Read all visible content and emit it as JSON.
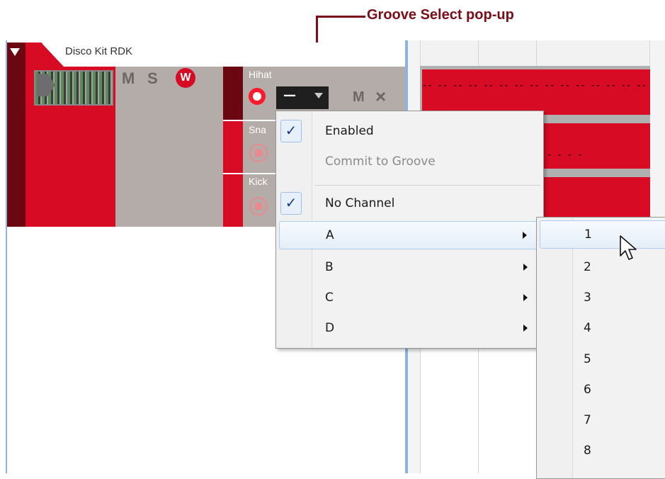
{
  "annotation": {
    "label": "Groove Select pop-up"
  },
  "track": {
    "name": "Disco Kit RDK",
    "mute_label": "M",
    "solo_label": "S",
    "wave_label": "W",
    "lanes": [
      {
        "label": "Hihat"
      },
      {
        "label": "Sna"
      },
      {
        "label": "Kick"
      }
    ],
    "lane_mute_label": "M",
    "lane_close_label": "×",
    "groove_select_value": "—"
  },
  "clips": {
    "hihat_notes": "-- -- -- -- -- -- -- -- -- -- -- -- -- -- -- -- -- -- -- -- -- -- -- -- --",
    "snare_notes": "-    -     -     -"
  },
  "groove_menu": {
    "items": [
      {
        "label": "Enabled",
        "checked": true,
        "enabled": true
      },
      {
        "label": "Commit to Groove",
        "checked": false,
        "enabled": false
      },
      {
        "label": "No Channel",
        "checked": true,
        "enabled": true
      },
      {
        "label": "A",
        "submenu": true,
        "highlighted": true
      },
      {
        "label": "B",
        "submenu": true
      },
      {
        "label": "C",
        "submenu": true
      },
      {
        "label": "D",
        "submenu": true
      }
    ],
    "check_glyph": "✓"
  },
  "channel_submenu": {
    "items": [
      "1",
      "2",
      "3",
      "4",
      "5",
      "6",
      "7",
      "8"
    ],
    "highlighted": "1"
  },
  "colors": {
    "track_red": "#d80b24",
    "track_dark": "#6b0710",
    "annotation": "#7a0d18",
    "menu_highlight_border": "#aecdf0"
  }
}
